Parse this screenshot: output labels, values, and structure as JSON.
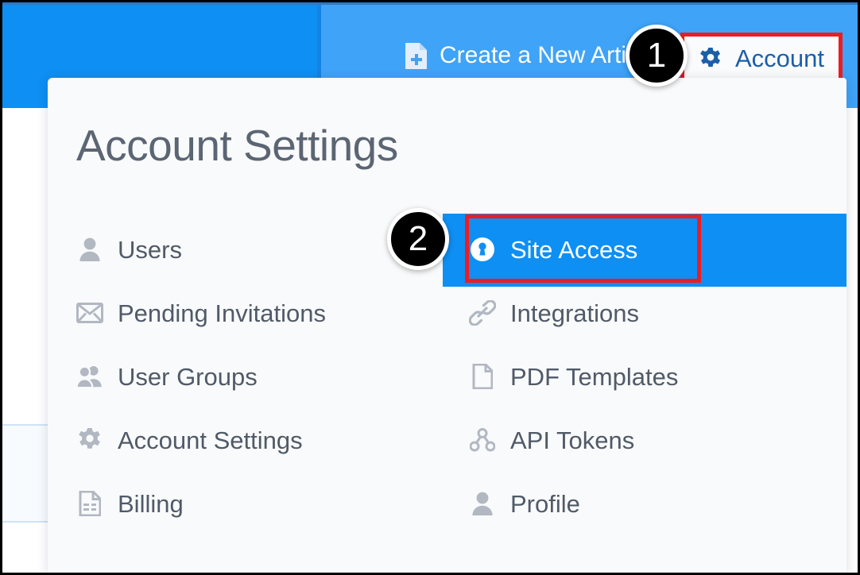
{
  "header": {
    "create_article": {
      "label": "Create a New Article",
      "icon": "document-plus-icon"
    },
    "account_button": {
      "label": "Account",
      "icon": "gear-icon"
    },
    "colors": {
      "blue_left": "#0e8ff4",
      "blue_right": "#3fa3f7",
      "accent_red": "#ee1c22"
    }
  },
  "dropdown": {
    "title": "Account Settings",
    "left_column": [
      {
        "label": "Users",
        "icon": "user-icon"
      },
      {
        "label": "Pending Invitations",
        "icon": "envelope-icon"
      },
      {
        "label": "User Groups",
        "icon": "users-group-icon"
      },
      {
        "label": "Account Settings",
        "icon": "gear-icon"
      },
      {
        "label": "Billing",
        "icon": "invoice-document-icon"
      }
    ],
    "right_column": [
      {
        "label": "Site Access",
        "icon": "lock-keyhole-icon",
        "selected": true
      },
      {
        "label": "Integrations",
        "icon": "chain-link-icon",
        "selected": false
      },
      {
        "label": "PDF Templates",
        "icon": "page-icon",
        "selected": false
      },
      {
        "label": "API Tokens",
        "icon": "sitemap-icon",
        "selected": false
      },
      {
        "label": "Profile",
        "icon": "user-icon",
        "selected": false
      }
    ]
  },
  "annotations": {
    "badge_1": "1",
    "badge_2": "2"
  }
}
